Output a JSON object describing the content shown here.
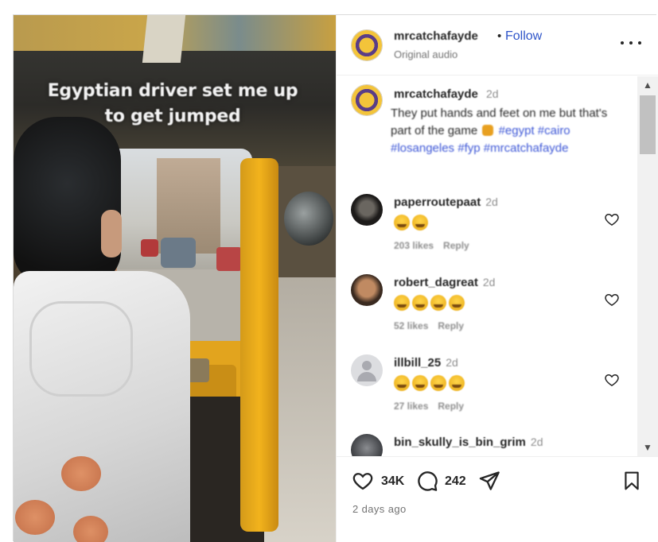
{
  "video": {
    "caption": "Egyptian driver set me up to get jumped"
  },
  "header": {
    "username": "mrcatchafayde",
    "separator": "•",
    "follow_label": "Follow",
    "audio": "Original audio",
    "more_icon": "more-horizontal-icon"
  },
  "post_caption": {
    "username": "mrcatchafayde",
    "time": "2d",
    "text": "They put hands and feet on me but that's part of the game",
    "emoji_icon": "fist-icon",
    "hashtags": [
      "#egypt",
      "#cairo",
      "#losangeles",
      "#fyp",
      "#mrcatchafayde"
    ]
  },
  "comments": [
    {
      "username": "paperroutepaat",
      "time": "2d",
      "emoji_count": 2,
      "emoji_icon": "loudly-crying-face-icon",
      "likes": "203 likes",
      "reply": "Reply"
    },
    {
      "username": "robert_dagreat",
      "time": "2d",
      "emoji_count": 4,
      "emoji_icon": "loudly-crying-face-icon",
      "likes": "52 likes",
      "reply": "Reply"
    },
    {
      "username": "illbill_25",
      "time": "2d",
      "emoji_count": 4,
      "emoji_icon": "loudly-crying-face-icon",
      "likes": "27 likes",
      "reply": "Reply"
    },
    {
      "username": "bin_skully_is_bin_grim",
      "time": "2d"
    }
  ],
  "actions": {
    "like_count": "34K",
    "comment_count": "242",
    "date": "2 days ago"
  },
  "colors": {
    "link_blue": "#2f55c9",
    "hashtag_blue": "#3b55d6",
    "text": "#262626",
    "muted": "#8e8e8e"
  }
}
